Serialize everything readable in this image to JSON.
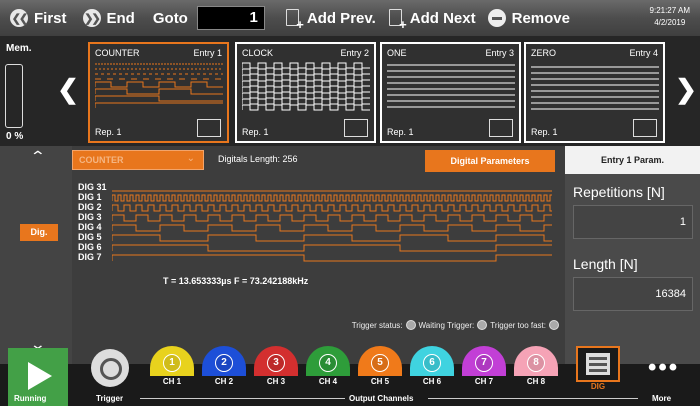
{
  "toolbar": {
    "first_label": "First",
    "end_label": "End",
    "goto_label": "Goto",
    "goto_value": "1",
    "add_prev_label": "Add Prev.",
    "add_next_label": "Add Next",
    "remove_label": "Remove",
    "time": "9:21:27 AM",
    "date": "4/2/2019"
  },
  "memory": {
    "label": "Mem.",
    "percent": "0 %"
  },
  "entries": [
    {
      "name": "COUNTER",
      "entry": "Entry 1",
      "rep": "Rep. 1",
      "active": true
    },
    {
      "name": "CLOCK",
      "entry": "Entry 2",
      "rep": "Rep. 1",
      "active": false
    },
    {
      "name": "ONE",
      "entry": "Entry 3",
      "rep": "Rep. 1",
      "active": false
    },
    {
      "name": "ZERO",
      "entry": "Entry 4",
      "rep": "Rep. 1",
      "active": false
    }
  ],
  "main": {
    "pattern_select": "COUNTER",
    "digitals_length": "Digitals Length: 256",
    "digital_params_button": "Digital Parameters",
    "dig_button": "Dig.",
    "channels": [
      "DIG 31",
      "DIG 1",
      "DIG 2",
      "DIG 3",
      "DIG 4",
      "DIG 5",
      "DIG 6",
      "DIG 7"
    ],
    "timing": "T =  13.653333µs  F =  73.242188kHz",
    "trigger_status": "Trigger status:",
    "waiting_trigger": "Waiting Trigger:",
    "trigger_too_fast": "Trigger too fast:"
  },
  "param_panel": {
    "title": "Entry  1  Param.",
    "repetitions_label": "Repetitions [N]",
    "repetitions_value": "1",
    "length_label": "Length [N]",
    "length_value": "16384"
  },
  "bottom": {
    "running_label": "Running",
    "trigger_label": "Trigger",
    "output_channels_label": "Output Channels",
    "more_label": "More",
    "dig_label": "DIG",
    "channels": [
      {
        "num": "1",
        "label": "CH 1",
        "color": "#e8d21d"
      },
      {
        "num": "2",
        "label": "CH 2",
        "color": "#1d4fd8"
      },
      {
        "num": "3",
        "label": "CH 3",
        "color": "#d32f2f"
      },
      {
        "num": "4",
        "label": "CH 4",
        "color": "#2e9d3a"
      },
      {
        "num": "5",
        "label": "CH 5",
        "color": "#f07a1a"
      },
      {
        "num": "6",
        "label": "CH 6",
        "color": "#3fd3e0"
      },
      {
        "num": "7",
        "label": "CH 7",
        "color": "#c23fd6"
      },
      {
        "num": "8",
        "label": "CH 8",
        "color": "#f5a3b6"
      }
    ]
  },
  "colors": {
    "accent": "#e8761d",
    "toolbar": "#555555",
    "panel": "#3d3d3d"
  }
}
